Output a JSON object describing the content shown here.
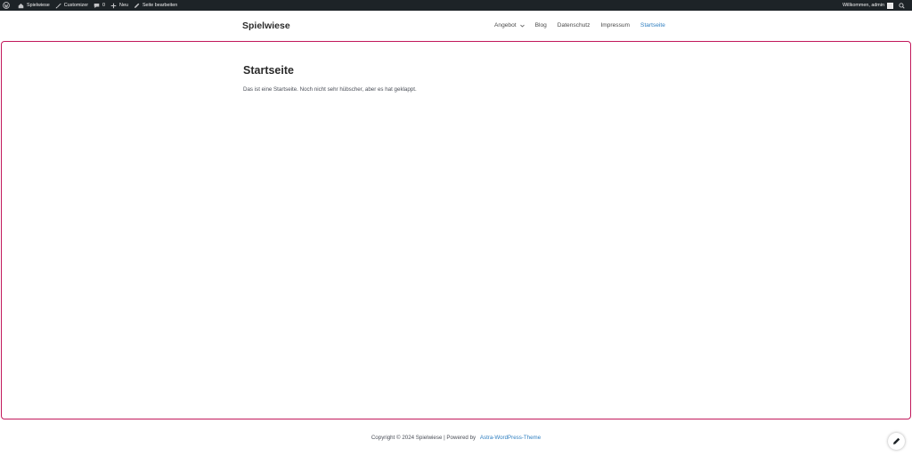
{
  "adminbar": {
    "site_name": "Spielwiese",
    "customizer": "Customizer",
    "comments_count": "0",
    "new": "Neu",
    "edit_page": "Seite bearbeiten",
    "welcome": "Willkommen, admin"
  },
  "header": {
    "site_title": "Spielwiese",
    "nav": [
      {
        "label": "Angebot",
        "has_dropdown": true
      },
      {
        "label": "Blog"
      },
      {
        "label": "Datenschutz"
      },
      {
        "label": "Impressum"
      },
      {
        "label": "Startseite",
        "active": true
      }
    ]
  },
  "main": {
    "title": "Startseite",
    "text": "Das ist eine Startseite. Noch nicht sehr hübscher, aber es hat geklappt."
  },
  "footer": {
    "copyright": "Copyright © 2024 Spielwiese | Powered by",
    "link": "Astra-WordPress-Theme"
  },
  "colors": {
    "adminbar_bg": "#1d2327",
    "accent": "#2f7fc1",
    "frame_border": "#c2185b"
  }
}
